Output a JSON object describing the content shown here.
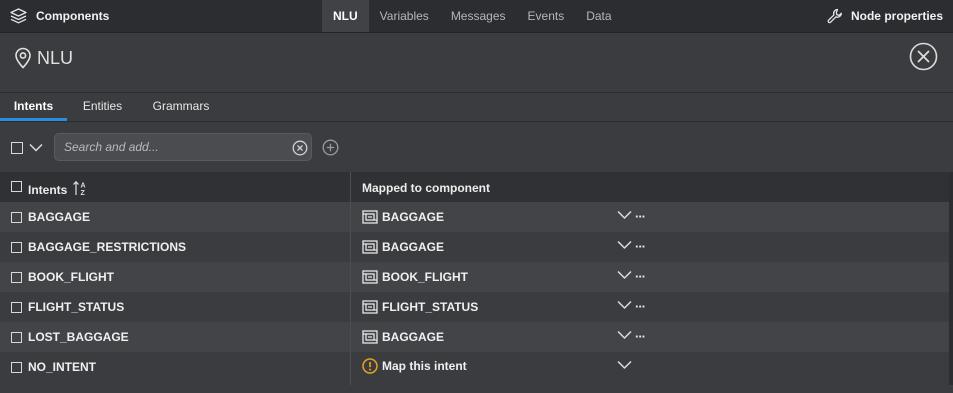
{
  "topbar": {
    "brand_label": "Components",
    "tabs": [
      {
        "label": "NLU",
        "active": true
      },
      {
        "label": "Variables"
      },
      {
        "label": "Messages"
      },
      {
        "label": "Events"
      },
      {
        "label": "Data"
      }
    ],
    "node_properties_label": "Node properties"
  },
  "header": {
    "title": "NLU"
  },
  "subtabs": [
    {
      "label": "Intents",
      "active": true
    },
    {
      "label": "Entities"
    },
    {
      "label": "Grammars"
    }
  ],
  "search": {
    "placeholder": "Search and add..."
  },
  "table": {
    "col_intents": "Intents",
    "col_mapped": "Mapped to component",
    "rows": [
      {
        "intent": "BAGGAGE",
        "component": "BAGGAGE",
        "mapped": true
      },
      {
        "intent": "BAGGAGE_RESTRICTIONS",
        "component": "BAGGAGE",
        "mapped": true
      },
      {
        "intent": "BOOK_FLIGHT",
        "component": "BOOK_FLIGHT",
        "mapped": true
      },
      {
        "intent": "FLIGHT_STATUS",
        "component": "FLIGHT_STATUS",
        "mapped": true
      },
      {
        "intent": "LOST_BAGGAGE",
        "component": "BAGGAGE",
        "mapped": true
      },
      {
        "intent": "NO_INTENT",
        "component": "Map this intent",
        "mapped": false
      }
    ]
  },
  "colors": {
    "accent": "#2d8fdc",
    "warning": "#e8a21f",
    "background": "#3b3c3f",
    "topbar": "#2c2d30"
  }
}
